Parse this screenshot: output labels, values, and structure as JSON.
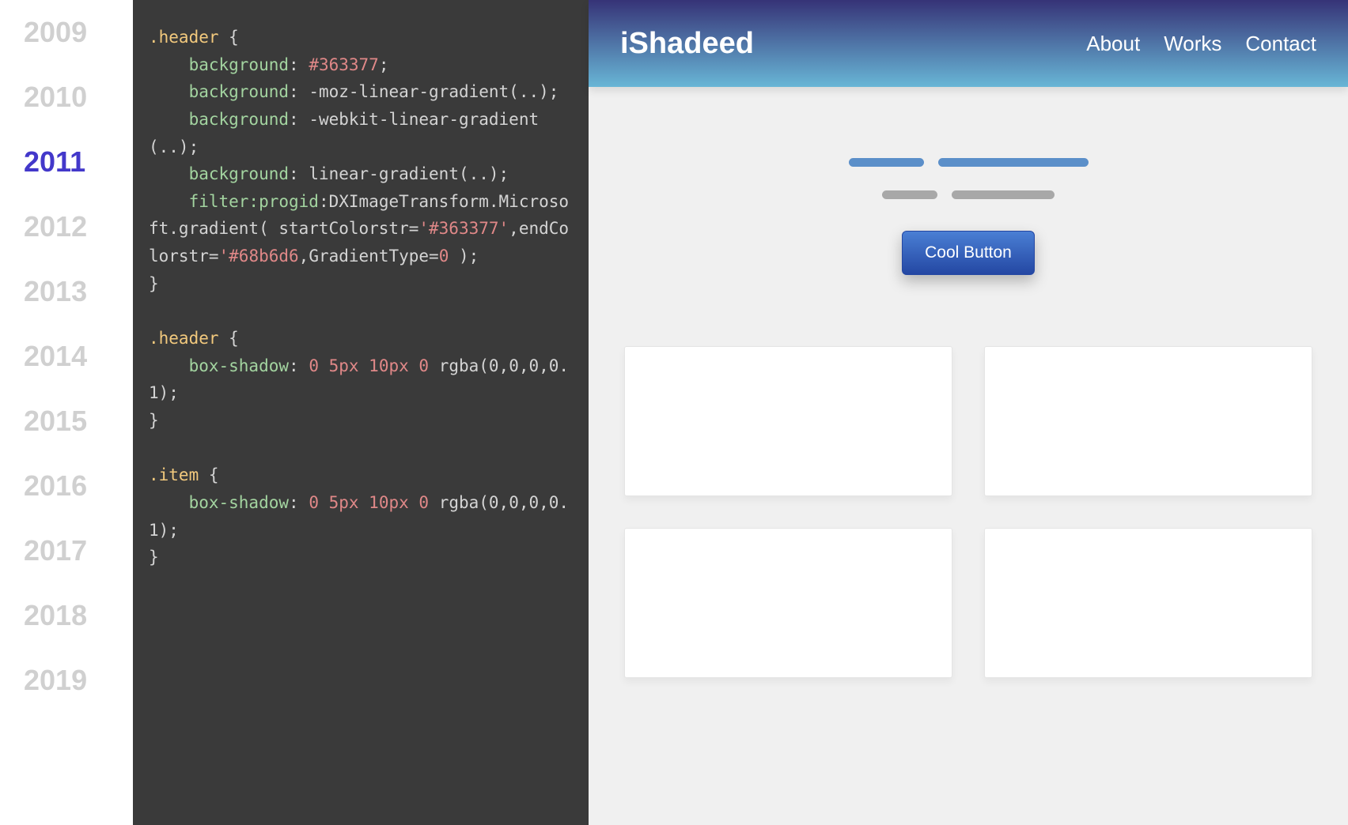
{
  "timeline": {
    "years": [
      "2009",
      "2010",
      "2011",
      "2012",
      "2013",
      "2014",
      "2015",
      "2016",
      "2017",
      "2018",
      "2019"
    ],
    "active": "2011"
  },
  "code": {
    "blocks": [
      {
        "selector": ".header",
        "lines": [
          {
            "prop": "background",
            "val": "#363377",
            "valHex": true
          },
          {
            "prop": "background",
            "val": "-moz-linear-gradient(..)"
          },
          {
            "prop": "background",
            "val": "-webkit-linear-gradient(..)"
          },
          {
            "prop": "background",
            "val": "linear-gradient(..)"
          },
          {
            "raw": "filter:progid:DXImageTransform.Microsoft.gradient( startColorstr='#363377',endColorstr='#68b6d6,GradientType=0 );"
          }
        ]
      },
      {
        "selector": ".header",
        "lines": [
          {
            "prop": "box-shadow",
            "val": "0 5px 10px 0 rgba(0,0,0,0.1)",
            "nums": true
          }
        ]
      },
      {
        "selector": ".item",
        "lines": [
          {
            "prop": "box-shadow",
            "val": "0 5px 10px 0 rgba(0,0,0,0.1)",
            "nums": true
          }
        ]
      }
    ],
    "filterParts": {
      "prefix": "filter:",
      "progid": "progid",
      "colon2": ":",
      "dx": "DXImageTransform.Microsoft.gradient( startColorstr=",
      "c1": "'#363377'",
      "mid": ",endColorstr=",
      "c2": "'#68b6d6",
      "tail": ",GradientType=",
      "zero": "0",
      "end": " );"
    }
  },
  "preview": {
    "brand": "iShadeed",
    "nav": [
      "About",
      "Works",
      "Contact"
    ],
    "button": "Cool Button"
  }
}
